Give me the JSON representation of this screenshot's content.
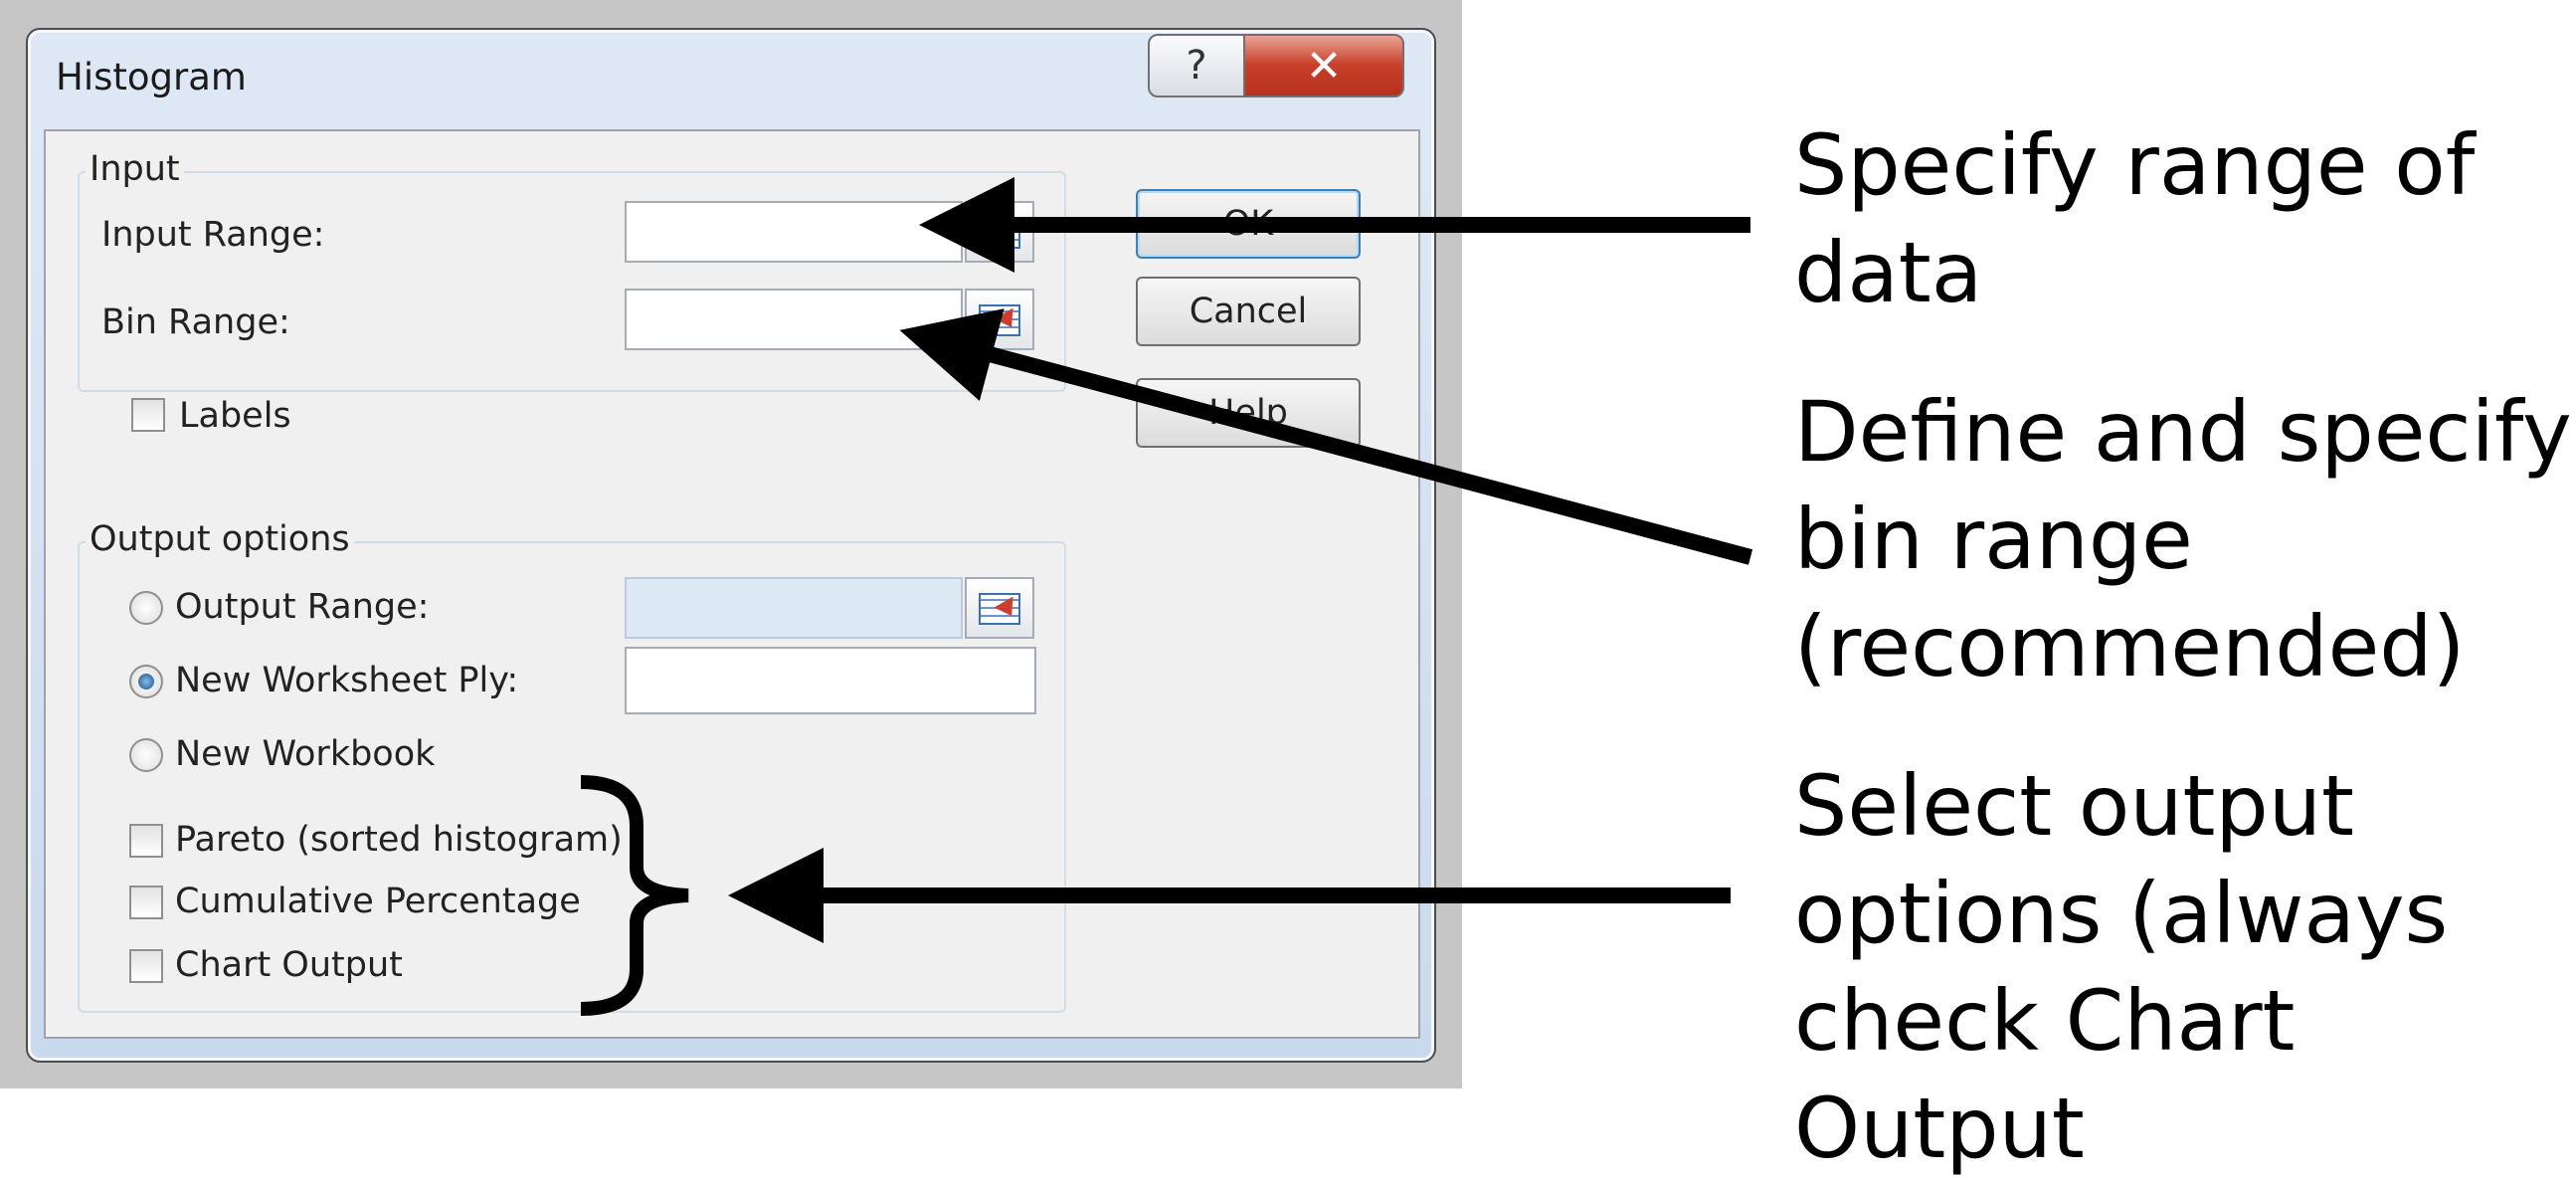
{
  "dialog": {
    "title": "Histogram",
    "help_icon": "question-icon",
    "close_icon": "close-icon",
    "input_group": {
      "label": "Input",
      "input_range_label": "Input Range:",
      "input_range_value": "",
      "bin_range_label": "Bin Range:",
      "bin_range_value": "",
      "labels_checkbox": {
        "label": "Labels",
        "checked": false
      }
    },
    "buttons": {
      "ok": "OK",
      "cancel": "Cancel",
      "help": "Help"
    },
    "output_group": {
      "label": "Output options",
      "output_range": {
        "label": "Output Range:",
        "selected": false,
        "value": ""
      },
      "new_worksheet": {
        "label": "New Worksheet Ply:",
        "selected": true,
        "value": ""
      },
      "new_workbook": {
        "label": "New Workbook",
        "selected": false
      },
      "pareto": {
        "label": "Pareto (sorted histogram)",
        "checked": false
      },
      "cumulative": {
        "label": "Cumulative Percentage",
        "checked": false
      },
      "chart_output": {
        "label": "Chart Output",
        "checked": false
      }
    }
  },
  "annotations": {
    "range": "Specify range of\ndata",
    "bin": "Define and specify\nbin range\n(recommended)",
    "output": "Select output\noptions (always\ncheck Chart Output"
  },
  "colors": {
    "close_button": "#c8402a",
    "dialog_frame": "#c9daee",
    "arrow": "#000000"
  }
}
